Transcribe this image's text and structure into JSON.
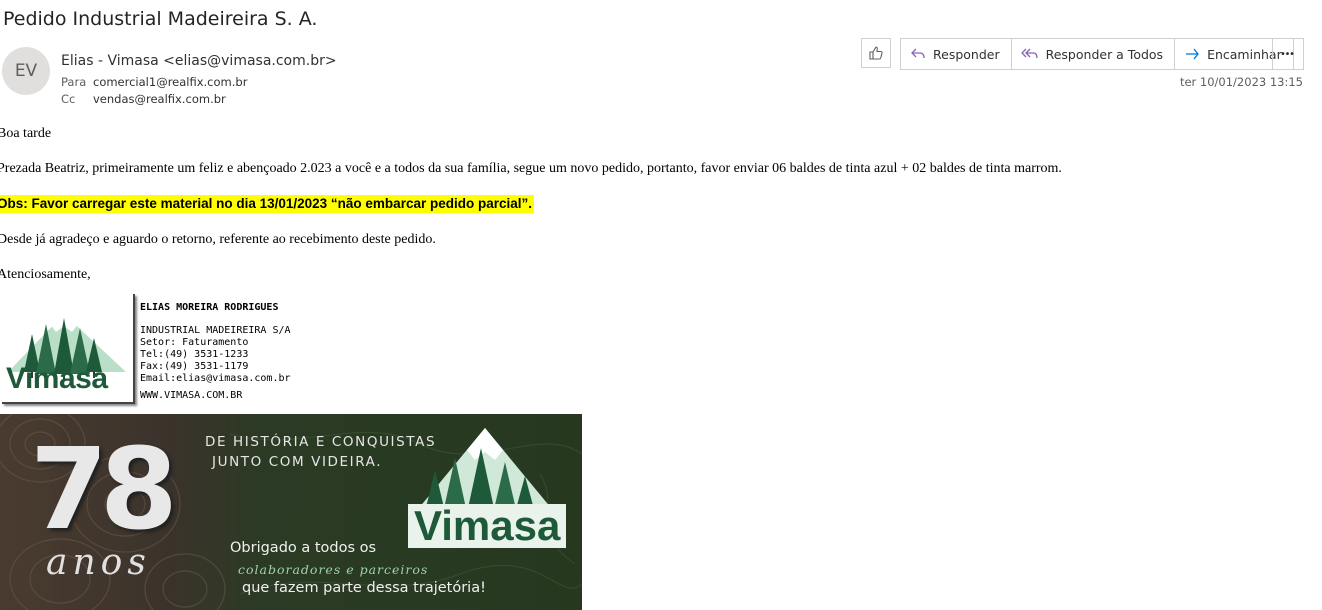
{
  "email": {
    "subject": "Pedido Industrial Madeireira S. A.",
    "avatar_initials": "EV",
    "sender": "Elias - Vimasa <elias@vimasa.com.br>",
    "to_label": "Para",
    "to": "comercial1@realfix.com.br",
    "cc_label": "Cc",
    "cc": "vendas@realfix.com.br",
    "timestamp": "ter 10/01/2023 13:15"
  },
  "toolbar": {
    "reply": "Responder",
    "reply_all": "Responder a Todos",
    "forward": "Encaminhar",
    "more": "•••"
  },
  "body": {
    "greeting": "Boa tarde",
    "paragraph1": "Prezada Beatriz, primeiramente um feliz e abençoado 2.023 a você e a todos da sua família, segue um novo pedido, portanto, favor enviar 06 baldes de tinta azul + 02 baldes de tinta marrom.",
    "obs": "Obs: Favor carregar este material no dia 13/01/2023 “não embarcar pedido parcial”.",
    "paragraph2": "Desde já agradeço e aguardo o retorno, referente ao recebimento deste pedido.",
    "closing": "Atenciosamente,"
  },
  "signature": {
    "logo_text": "Vimasa",
    "name": "ELIAS MOREIRA RODRIGUES",
    "company": "INDUSTRIAL MADEIREIRA S/A",
    "sector": "Setor: Faturamento",
    "tel": "Tel:(49) 3531-1233",
    "fax": "Fax:(49) 3531-1179",
    "email": "Email:elias@vimasa.com.br",
    "website": "WWW.VIMASA.COM.BR"
  },
  "banner": {
    "number": "78",
    "anos": "anos",
    "headline1": "DE HISTÓRIA E CONQUISTAS",
    "headline2": "JUNTO COM VIDEIRA.",
    "thanks1": "Obrigado a todos os",
    "thanks2": "colaboradores e parceiros",
    "thanks3": "que fazem parte dessa trajetória!",
    "logo_text": "Vimasa"
  },
  "colors": {
    "accent": "#8764b8",
    "forward": "#0078d4",
    "brand_green": "#1e5a3a",
    "highlight": "#ffff00"
  }
}
